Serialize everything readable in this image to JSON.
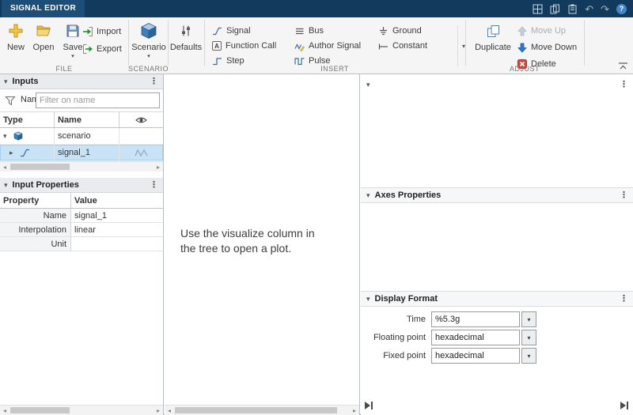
{
  "colors": {
    "titlebar_bg": "#123a5c",
    "tab_active_bg": "#1d4e77",
    "selection_blue": "#c8e3f6",
    "accent_blue": "#2e78c9",
    "delete_red": "#d64540",
    "import_green": "#2f8f2f",
    "new_gold": "#f7c63f"
  },
  "titlebar": {
    "tab_label": "SIGNAL EDITOR"
  },
  "icons": {
    "kebab": "⋮",
    "chevron_down": "▾",
    "chevron_right": "▸",
    "dropdown_arrow": "▾",
    "undo": "↶",
    "redo": "↷",
    "help": "?",
    "scroll_left": "◂",
    "scroll_right": "▸",
    "function_call_glyph": "A"
  },
  "ribbon": {
    "file": {
      "section_label": "FILE",
      "new_label": "New",
      "open_label": "Open",
      "save_label": "Save",
      "import_label": "Import",
      "export_label": "Export"
    },
    "scenario": {
      "section_label": "SCENARIO",
      "scenario_label": "Scenario"
    },
    "defaults_label": "Defaults",
    "insert": {
      "section_label": "INSERT",
      "signal_label": "Signal",
      "function_call_label": "Function Call",
      "step_label": "Step",
      "bus_label": "Bus",
      "author_signal_label": "Author Signal",
      "pulse_label": "Pulse",
      "ground_label": "Ground",
      "constant_label": "Constant"
    },
    "adjust": {
      "section_label": "ADJUST",
      "duplicate_label": "Duplicate",
      "move_up_label": "Move Up",
      "move_down_label": "Move Down",
      "delete_label": "Delete"
    }
  },
  "inputs_panel": {
    "title": "Inputs",
    "filter_label": "Name",
    "filter_placeholder": "Filter on name",
    "filter_value": "",
    "columns": {
      "type": "Type",
      "name": "Name"
    },
    "rows": [
      {
        "name": "scenario",
        "type": "scenario",
        "expanded": true,
        "selected": false
      },
      {
        "name": "signal_1",
        "type": "signal",
        "expanded": false,
        "selected": true
      }
    ]
  },
  "properties_panel": {
    "title": "Input Properties",
    "columns": {
      "property": "Property",
      "value": "Value"
    },
    "rows": [
      {
        "property": "Name",
        "value": "signal_1"
      },
      {
        "property": "Interpolation",
        "value": "linear"
      },
      {
        "property": "Unit",
        "value": ""
      }
    ]
  },
  "canvas": {
    "message_line1": "Use the visualize column in",
    "message_line2": "the tree to open a plot."
  },
  "right_panel": {
    "axes_section_title": "Axes Properties",
    "display_section_title": "Display Format",
    "fields": {
      "time_label": "Time",
      "time_value": "%5.3g",
      "floating_label": "Floating point",
      "floating_value": "hexadecimal",
      "fixed_label": "Fixed point",
      "fixed_value": "hexadecimal"
    }
  }
}
